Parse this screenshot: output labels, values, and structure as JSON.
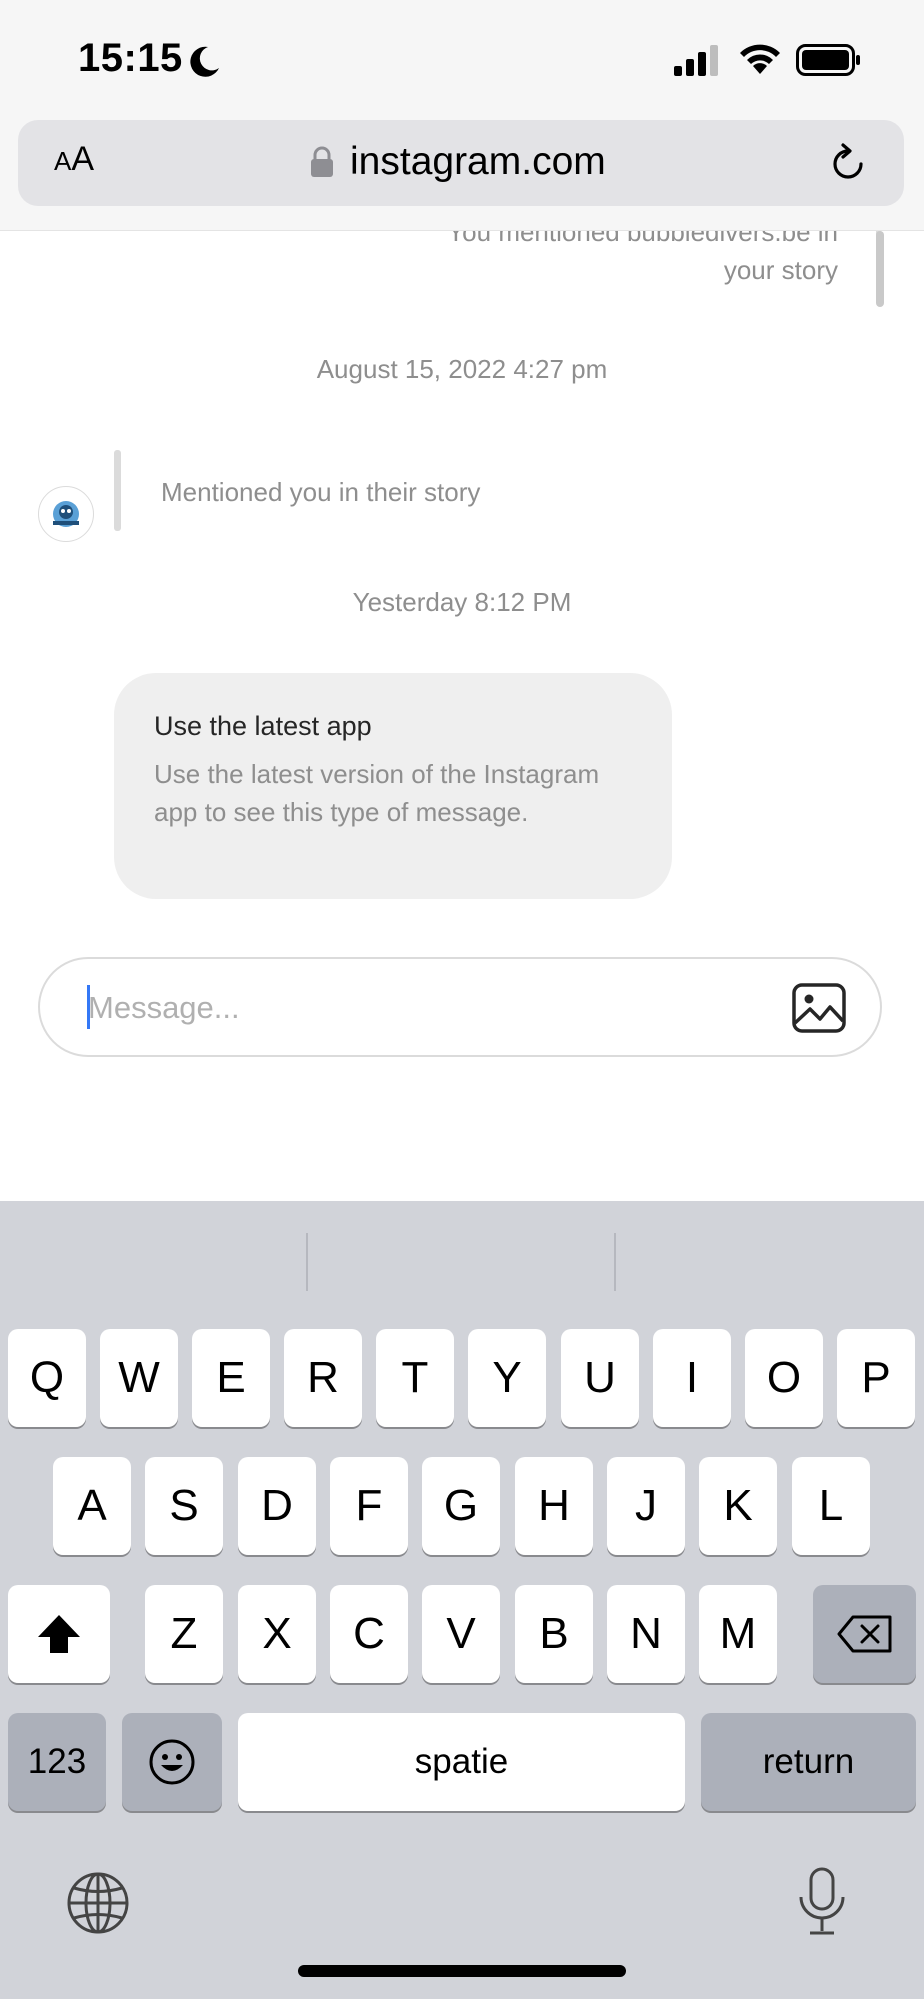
{
  "status_bar": {
    "time": "15:15"
  },
  "browser": {
    "aa_label": "AA",
    "url": "instagram.com"
  },
  "chat": {
    "previous_mention_line1": "You mentioned bubbledivers.be in",
    "previous_mention_line2": "your story",
    "timestamp_1": "August 15, 2022 4:27 pm",
    "mention_text": "Mentioned you in their story",
    "timestamp_2": "Yesterday 8:12 PM",
    "bubble_title": "Use the latest app",
    "bubble_body": "Use the latest version of the Instagram app to see this type of message."
  },
  "composer": {
    "placeholder": "Message..."
  },
  "keyboard": {
    "row1": [
      "Q",
      "W",
      "E",
      "R",
      "T",
      "Y",
      "U",
      "I",
      "O",
      "P"
    ],
    "row2": [
      "A",
      "S",
      "D",
      "F",
      "G",
      "H",
      "J",
      "K",
      "L"
    ],
    "row3": [
      "Z",
      "X",
      "C",
      "V",
      "B",
      "N",
      "M"
    ],
    "numbers_label": "123",
    "space_label": "spatie",
    "return_label": "return"
  }
}
